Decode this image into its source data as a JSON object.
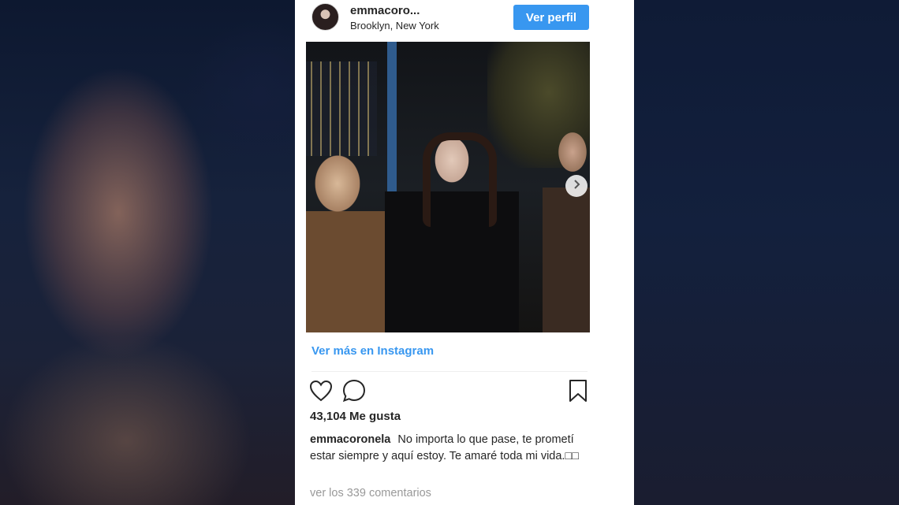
{
  "colors": {
    "accent": "#3897f0",
    "text": "#262626",
    "muted": "#999999",
    "divider": "#efefef"
  },
  "post": {
    "username": "emmacoro...",
    "location": "Brooklyn, New York",
    "view_profile_label": "Ver perfil",
    "next_icon": "chevron-right-icon",
    "more_link": "Ver más en Instagram",
    "likes": "43,104 Me gusta",
    "caption_user": "emmacoronela",
    "caption_text": "No importa lo que pase, te prometí estar siempre y aquí estoy. Te amaré toda mi vida.□□",
    "comments_link": "ver los 339 comentarios",
    "icons": [
      "heart-icon",
      "comment-icon",
      "bookmark-icon"
    ]
  }
}
